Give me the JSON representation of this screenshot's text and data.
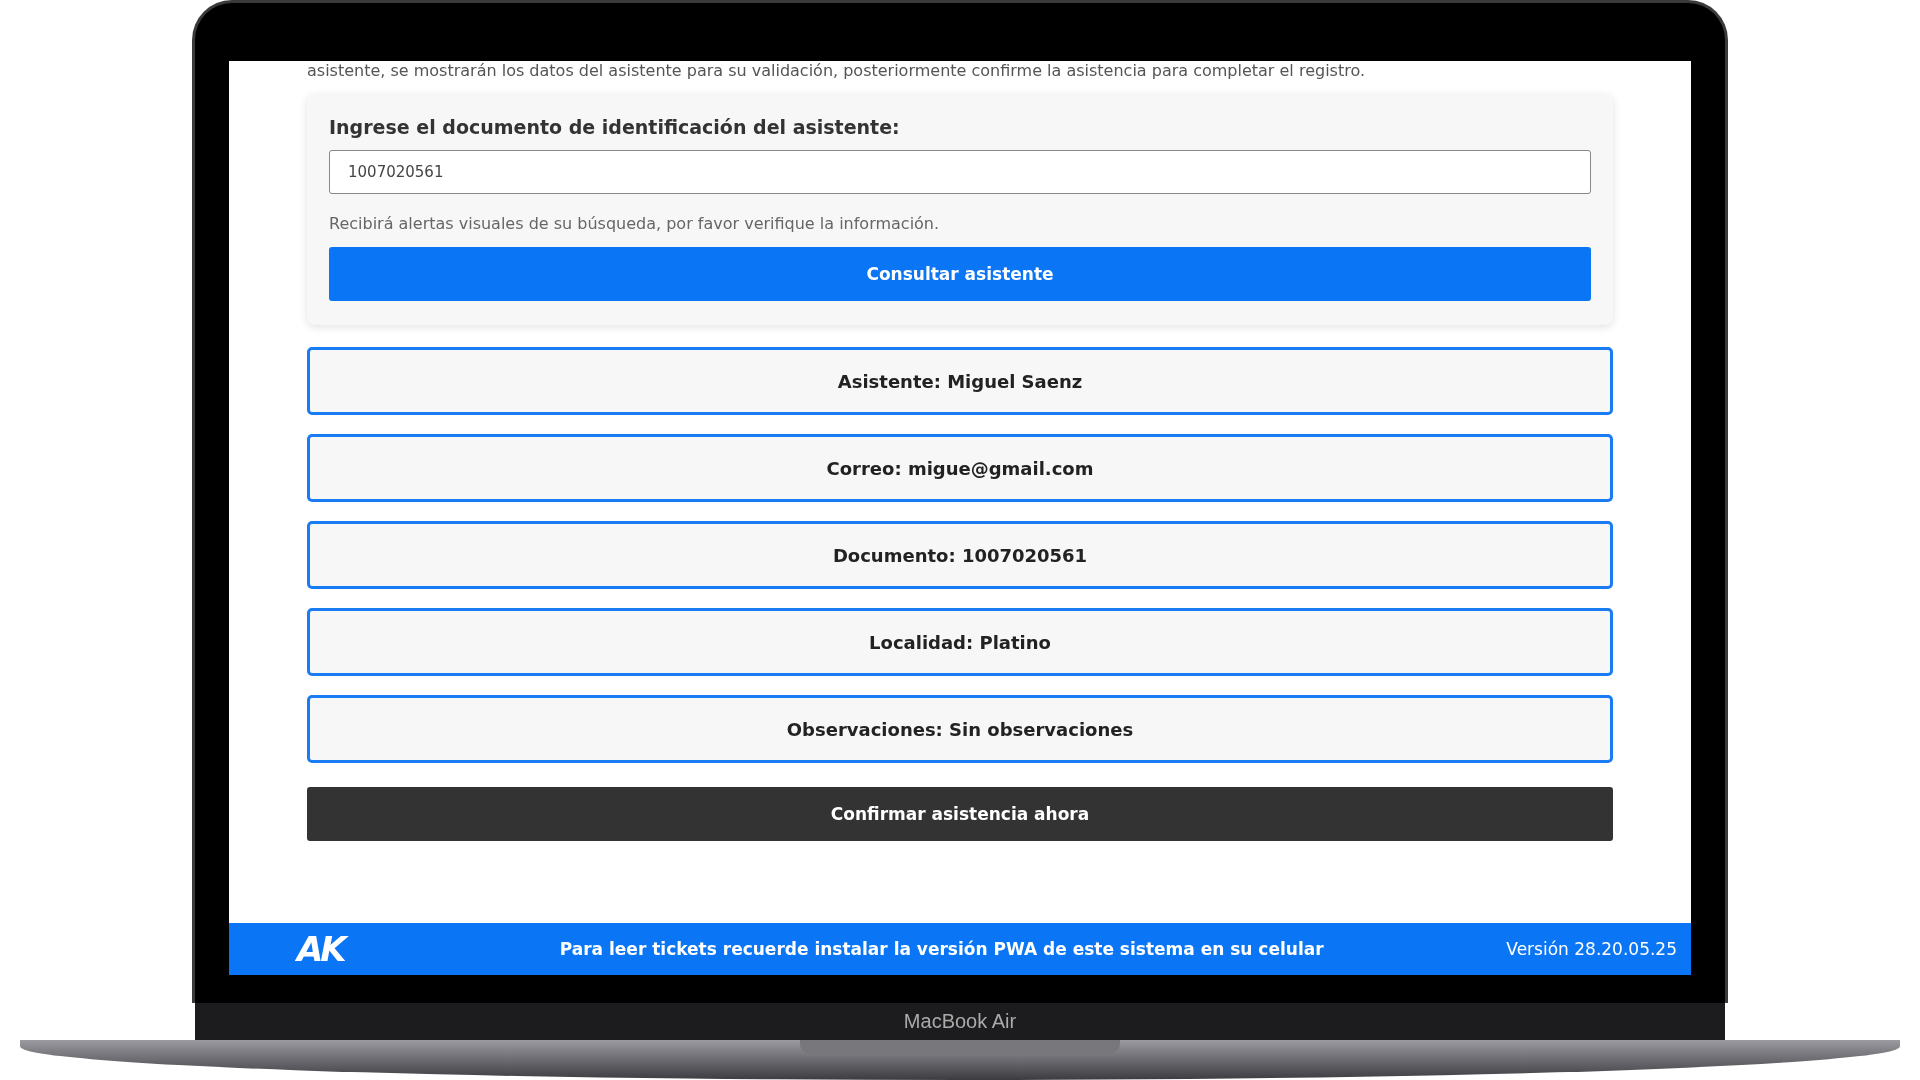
{
  "intro": "asistente, se mostrarán los datos del asistente para su validación, posteriormente confirme la asistencia para completar el registro.",
  "search": {
    "label": "Ingrese el documento de identificación del asistente:",
    "value": "1007020561",
    "hint": "Recibirá alertas visuales de su búsqueda, por favor verifique la información.",
    "button": "Consultar asistente"
  },
  "details": [
    "Asistente: Miguel Saenz",
    "Correo: migue@gmail.com",
    "Documento: 1007020561",
    "Localidad: Platino",
    "Observaciones: Sin observaciones"
  ],
  "confirm_button": "Confirmar asistencia ahora",
  "footer": {
    "logo": "AK",
    "message": "Para leer tickets recuerde instalar la versión PWA de este sistema en su celular",
    "version": "Versión 28.20.05.25"
  },
  "device_label": "MacBook Air"
}
